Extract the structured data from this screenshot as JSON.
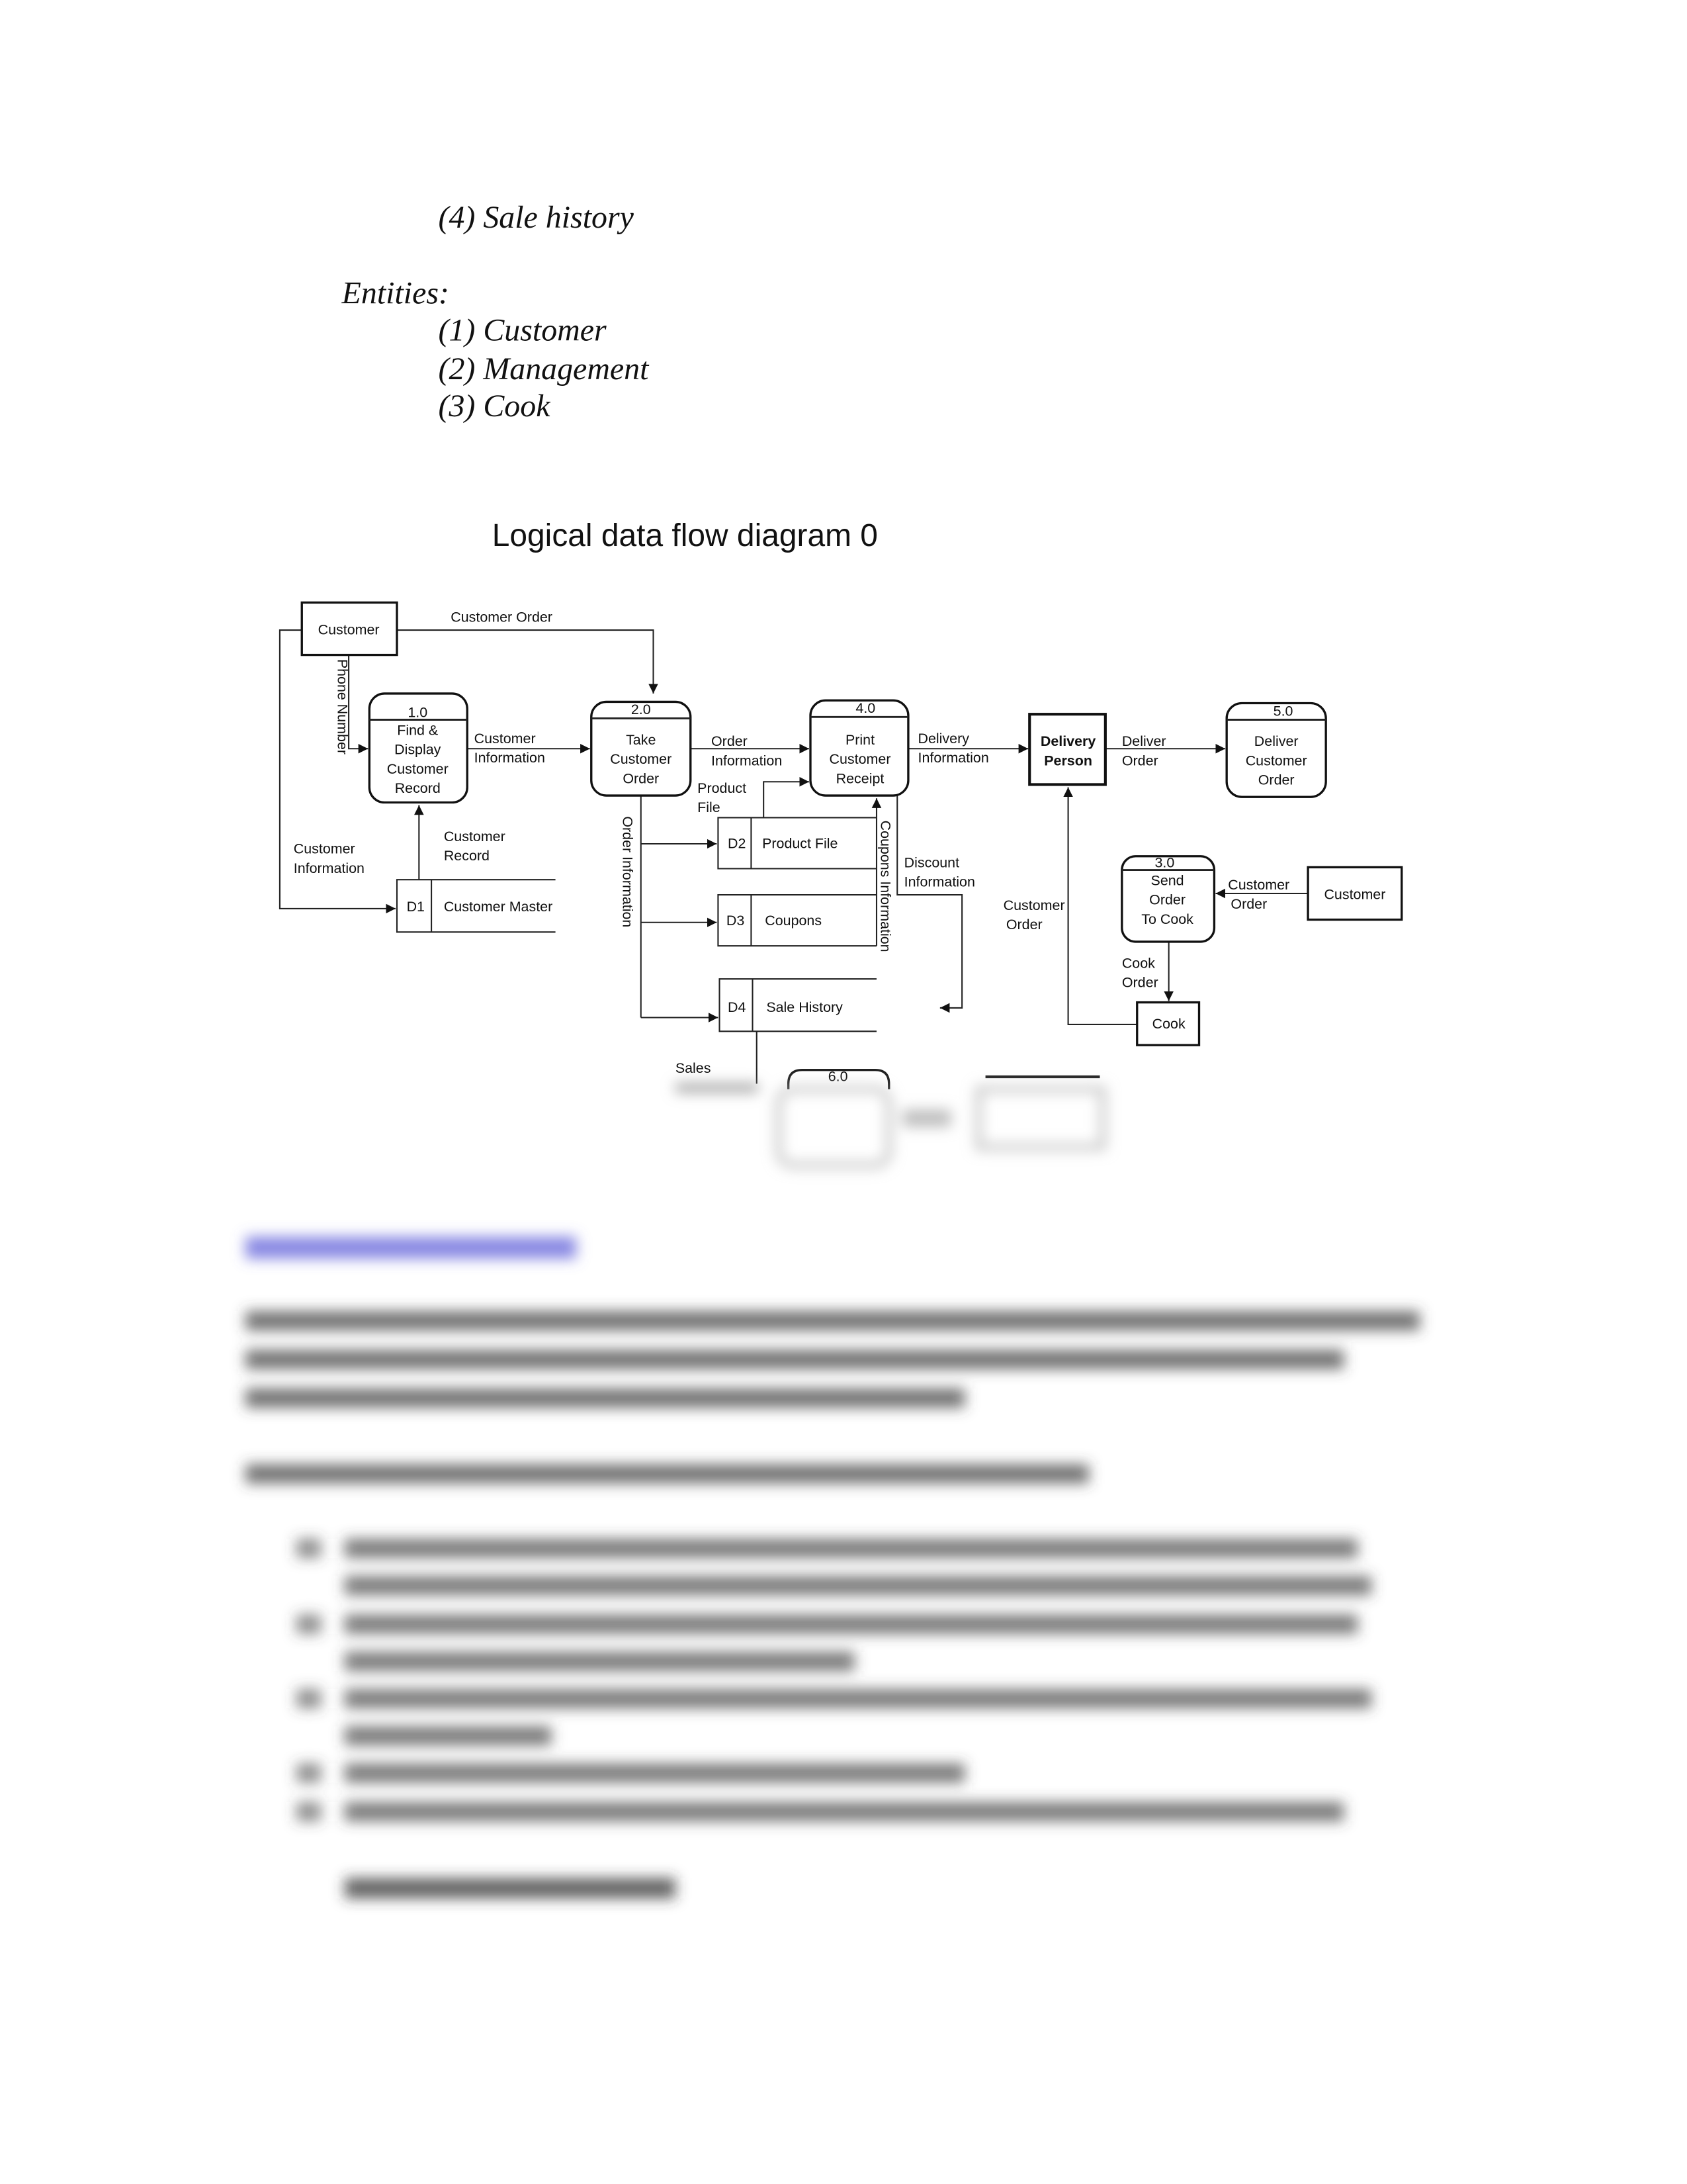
{
  "document": {
    "list_tail": "(4) Sale history",
    "entities_heading": "Entities:",
    "entities": [
      "(1) Customer",
      "(2) Management",
      "(3) Cook"
    ],
    "diagram_title": "Logical data flow diagram 0"
  },
  "diagram": {
    "entities": {
      "customer_top": "Customer",
      "customer_right": "Customer",
      "delivery_person": [
        "Delivery",
        "Person"
      ],
      "cook": "Cook"
    },
    "processes": [
      {
        "id": "1.0",
        "lines": [
          "Find &",
          "Display",
          "Customer",
          "Record"
        ]
      },
      {
        "id": "2.0",
        "lines": [
          "Take",
          "Customer",
          "Order"
        ]
      },
      {
        "id": "4.0",
        "lines": [
          "Print",
          "Customer",
          "Receipt"
        ]
      },
      {
        "id": "5.0",
        "lines": [
          "Deliver",
          "Customer",
          "Order"
        ]
      },
      {
        "id": "3.0",
        "lines": [
          "Send",
          "Order",
          "To Cook"
        ]
      },
      {
        "id": "6.0",
        "lines": []
      }
    ],
    "stores": [
      {
        "id": "D1",
        "name": "Customer Master"
      },
      {
        "id": "D2",
        "name": "Product File"
      },
      {
        "id": "D3",
        "name": "Coupons"
      },
      {
        "id": "D4",
        "name": "Sale History"
      }
    ],
    "flows": {
      "customer_order_top": "Customer Order",
      "phone_number": "Phone Number",
      "customer_information_left": [
        "Customer",
        "Information"
      ],
      "customer_record": [
        "Customer",
        "Record"
      ],
      "customer_information": [
        "Customer",
        "Information"
      ],
      "order_information": [
        "Order",
        "Information"
      ],
      "order_information_vertical": "Order Information",
      "product_file": [
        "Product",
        "File"
      ],
      "coupons_information": "Coupons Information",
      "discount_information": [
        "Discount",
        "Information"
      ],
      "delivery_information": [
        "Delivery",
        "Information"
      ],
      "deliver_order": [
        "Deliver",
        "Order"
      ],
      "customer_order_right": [
        "Customer",
        "Order"
      ],
      "customer_order_mid": [
        "Customer",
        "Order"
      ],
      "cook_order": [
        "Cook",
        "Order"
      ],
      "sales": "Sales"
    }
  },
  "colors": {
    "blurred_heading": "#6b6bdc",
    "blurred_text": "#444444"
  }
}
